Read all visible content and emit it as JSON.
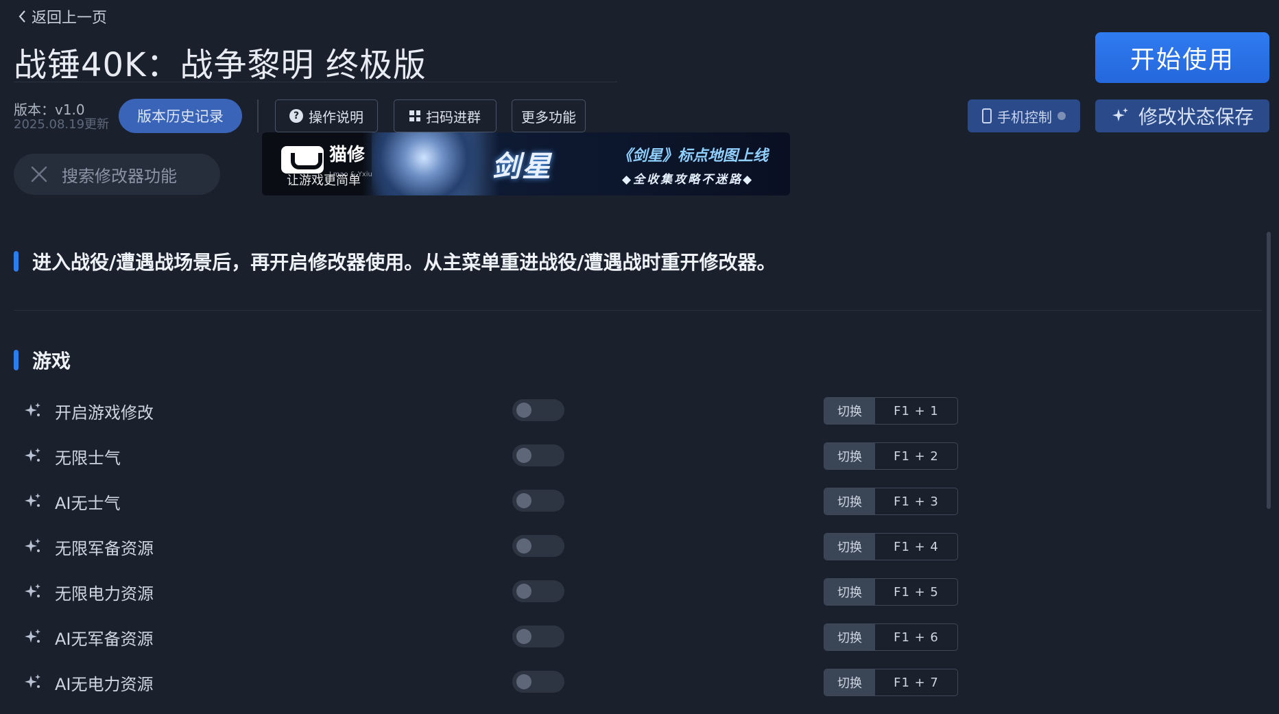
{
  "header": {
    "back_label": "返回上一页",
    "title": "战锤40K：战争黎明 终极版",
    "start_label": "开始使用"
  },
  "version": {
    "label": "版本：v1.0",
    "date": "2025.08.19更新"
  },
  "toolbar": {
    "history_label": "版本历史记录",
    "help_label": "操作说明",
    "qr_label": "扫码进群",
    "more_label": "更多功能",
    "phone_label": "手机控制",
    "save_label": "修改状态保存"
  },
  "search": {
    "placeholder": "搜索修改器功能"
  },
  "banner": {
    "brand": "猫修",
    "brand_small": "Lmao & Yxiu",
    "tagline": "让游戏更简单",
    "game_name": "剑星",
    "promo_line1": "《剑星》标点地图上线",
    "promo_line2": "◆全收集攻略不迷路◆"
  },
  "notice": {
    "text": "进入战役/遭遇战场景后，再开启修改器使用。从主菜单重进战役/遭遇战时重开修改器。"
  },
  "section": {
    "title": "游戏"
  },
  "options": [
    {
      "label": "开启游戏修改",
      "enabled": false,
      "action": "切换",
      "hotkey": "F1 + 1"
    },
    {
      "label": "无限士气",
      "enabled": false,
      "action": "切换",
      "hotkey": "F1 + 2"
    },
    {
      "label": "AI无士气",
      "enabled": false,
      "action": "切换",
      "hotkey": "F1 + 3"
    },
    {
      "label": "无限军备资源",
      "enabled": false,
      "action": "切换",
      "hotkey": "F1 + 4"
    },
    {
      "label": "无限电力资源",
      "enabled": false,
      "action": "切换",
      "hotkey": "F1 + 5"
    },
    {
      "label": "AI无军备资源",
      "enabled": false,
      "action": "切换",
      "hotkey": "F1 + 6"
    },
    {
      "label": "AI无电力资源",
      "enabled": false,
      "action": "切换",
      "hotkey": "F1 + 7"
    }
  ],
  "colors": {
    "background": "#1a202c",
    "accent": "#2f7bf0",
    "toggle_off": "#2e3542"
  }
}
